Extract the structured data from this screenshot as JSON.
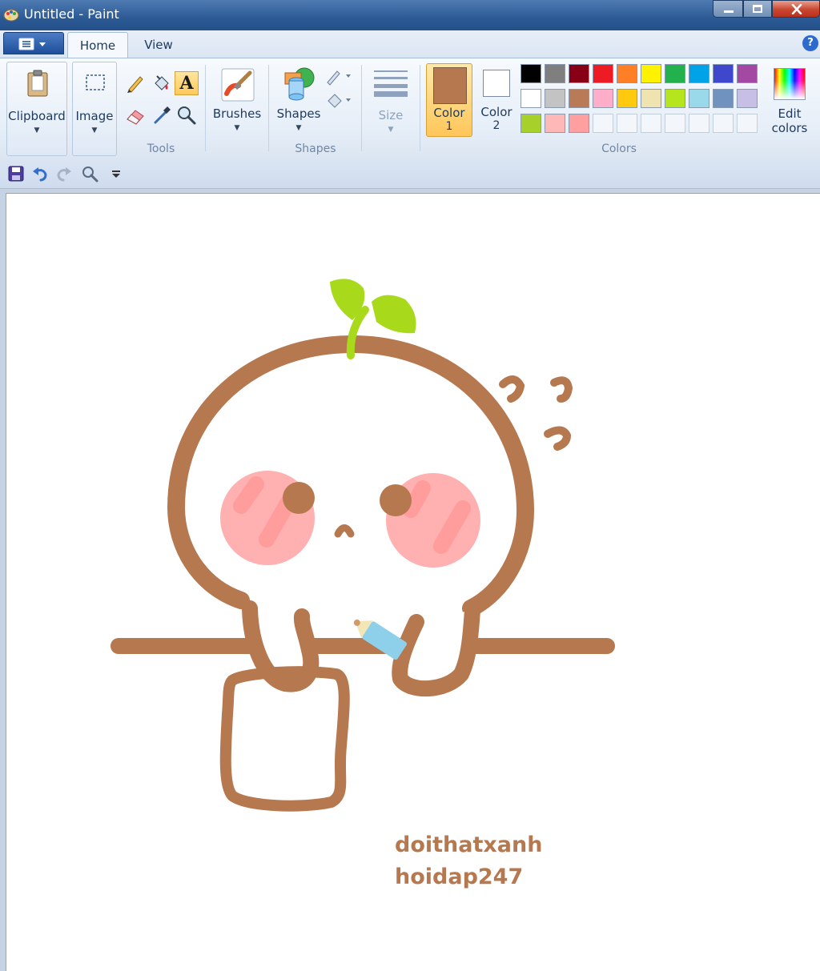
{
  "window": {
    "title": "Untitled - Paint"
  },
  "tabs": [
    {
      "label": "Home"
    },
    {
      "label": "View"
    }
  ],
  "ribbon": {
    "clipboard": {
      "label": "Clipboard"
    },
    "image": {
      "label": "Image"
    },
    "tools": {
      "group_label": "Tools",
      "selected": "text-tool"
    },
    "brushes": {
      "label": "Brushes"
    },
    "shapes": {
      "label": "Shapes",
      "group_label": "Shapes"
    },
    "size": {
      "label": "Size"
    },
    "color1": {
      "label_line1": "Color",
      "label_line2": "1",
      "value": "#b5784f"
    },
    "color2": {
      "label_line1": "Color",
      "label_line2": "2",
      "value": "#ffffff"
    },
    "colors": {
      "group_label": "Colors",
      "row1": [
        "#000000",
        "#7f7f7f",
        "#880015",
        "#ed1c24",
        "#ff7f27",
        "#fff200",
        "#22b14c",
        "#00a2e8",
        "#3f48cc",
        "#a349a4"
      ],
      "row2": [
        "#ffffff",
        "#c3c3c3",
        "#b97a57",
        "#ffaec9",
        "#ffc90e",
        "#efe4b0",
        "#b5e61d",
        "#99d9ea",
        "#7092be",
        "#c8bfe7"
      ],
      "row3": [
        "#a8d02a",
        "#ffb8b8",
        "#ff9f9f",
        "",
        "",
        "",
        "",
        "",
        "",
        ""
      ]
    },
    "edit_colors": {
      "label_line1": "Edit",
      "label_line2": "colors"
    }
  },
  "canvas": {
    "watermark_line1": "doithatxanh",
    "watermark_line2": "hoidap247",
    "stroke_color": "#b5784f",
    "leaf_color": "#a8d91a",
    "blush_color": "#ffb0b0"
  }
}
